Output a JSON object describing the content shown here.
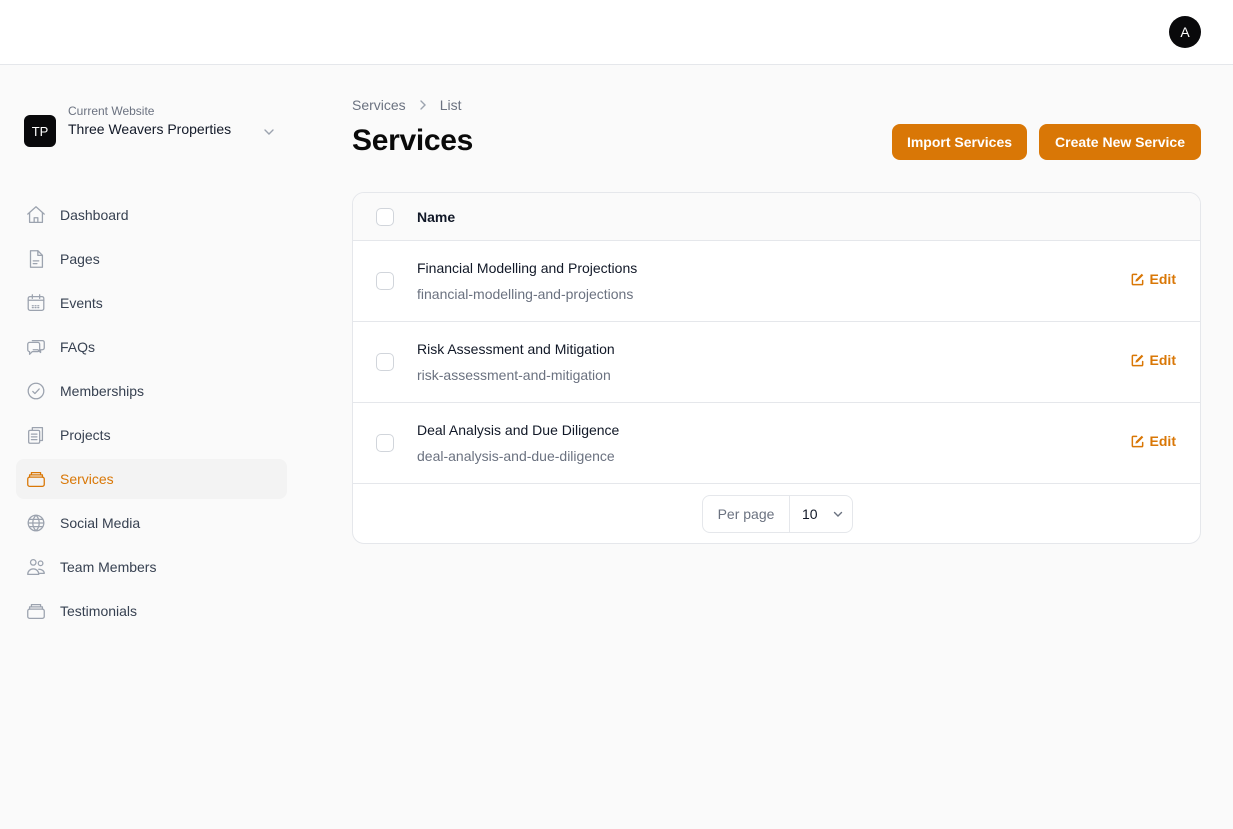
{
  "user": {
    "avatar_initial": "A"
  },
  "site": {
    "caption": "Current Website",
    "name": "Three Weavers Properties",
    "logo_initials": "TP"
  },
  "nav": {
    "items": [
      {
        "label": "Dashboard",
        "icon": "home-icon",
        "active": false
      },
      {
        "label": "Pages",
        "icon": "document-icon",
        "active": false
      },
      {
        "label": "Events",
        "icon": "calendar-icon",
        "active": false
      },
      {
        "label": "FAQs",
        "icon": "chat-bubbles-icon",
        "active": false
      },
      {
        "label": "Memberships",
        "icon": "badge-check-icon",
        "active": false
      },
      {
        "label": "Projects",
        "icon": "clipboard-icon",
        "active": false
      },
      {
        "label": "Services",
        "icon": "stack-icon",
        "active": true
      },
      {
        "label": "Social Media",
        "icon": "globe-icon",
        "active": false
      },
      {
        "label": "Team Members",
        "icon": "users-icon",
        "active": false
      },
      {
        "label": "Testimonials",
        "icon": "stack-icon",
        "active": false
      }
    ]
  },
  "breadcrumb": {
    "items": [
      "Services",
      "List"
    ]
  },
  "page": {
    "title": "Services"
  },
  "actions": {
    "import_label": "Import Services",
    "create_label": "Create New Service"
  },
  "table": {
    "columns": [
      "Name"
    ],
    "edit_label": "Edit",
    "rows": [
      {
        "title": "Financial Modelling and Projections",
        "slug": "financial-modelling-and-projections"
      },
      {
        "title": "Risk Assessment and Mitigation",
        "slug": "risk-assessment-and-mitigation"
      },
      {
        "title": "Deal Analysis and Due Diligence",
        "slug": "deal-analysis-and-due-diligence"
      }
    ]
  },
  "pagination": {
    "per_page_label": "Per page",
    "per_page_value": "10"
  },
  "colors": {
    "accent": "#d97706",
    "dark": "#09090b"
  }
}
